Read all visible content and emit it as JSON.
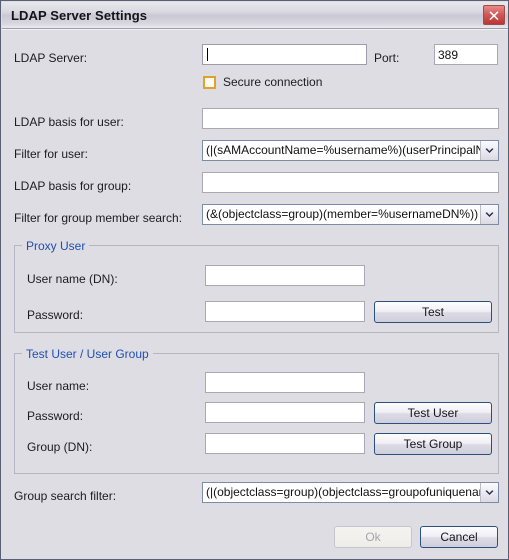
{
  "window": {
    "title": "LDAP Server Settings",
    "close_icon": "close-icon"
  },
  "server": {
    "ldap_server_label": "LDAP Server:",
    "ldap_server_value": "",
    "ldap_server_placeholder": "",
    "port_label": "Port:",
    "port_value": "389",
    "secure_connection_label": "Secure connection",
    "secure_connection_checked": false
  },
  "filters": {
    "ldap_basis_user_label": "LDAP basis for user:",
    "ldap_basis_user_value": "",
    "filter_user_label": "Filter for user:",
    "filter_user_value": "(|(sAMAccountName=%username%)(userPrincipalName=%",
    "ldap_basis_group_label": "LDAP basis for group:",
    "ldap_basis_group_value": "",
    "filter_group_member_label": "Filter for group member search:",
    "filter_group_member_value": "(&(objectclass=group)(member=%usernameDN%))"
  },
  "proxy_user": {
    "legend": "Proxy User",
    "username_label": "User name (DN):",
    "username_value": "",
    "password_label": "Password:",
    "password_value": "",
    "test_button": "Test"
  },
  "test_user": {
    "legend": "Test User / User Group",
    "username_label": "User name:",
    "username_value": "",
    "password_label": "Password:",
    "password_value": "",
    "group_label": "Group (DN):",
    "group_value": "",
    "test_user_button": "Test User",
    "test_group_button": "Test Group"
  },
  "group_search": {
    "label": "Group search filter:",
    "value": "(|(objectclass=group)(objectclass=groupofuniquenames))"
  },
  "footer": {
    "ok_button": "Ok",
    "ok_enabled": false,
    "cancel_button": "Cancel"
  },
  "colors": {
    "dialog_background": "#dedde3",
    "legend_text": "#1f4fb0",
    "button_border": "#2b4f7e",
    "checkbox_border": "#e3a12c",
    "close_button": "#b83636"
  }
}
